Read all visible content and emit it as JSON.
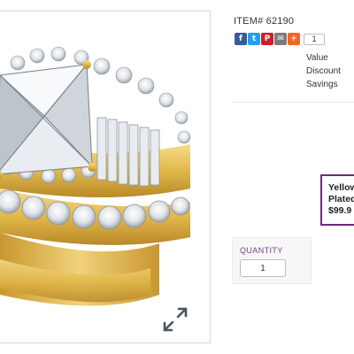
{
  "product": {
    "item_number": "ITEM# 62190",
    "image_alt": "Princess-cut cubic zirconia bridal ring set, yellow gold plated"
  },
  "share": {
    "buttons": [
      {
        "icon": "facebook-icon",
        "glyph": "f",
        "color": "#3b5998"
      },
      {
        "icon": "twitter-icon",
        "glyph": "t",
        "color": "#1da1f2"
      },
      {
        "icon": "pinterest-icon",
        "glyph": "P",
        "color": "#cb2027"
      },
      {
        "icon": "email-icon",
        "glyph": "✉",
        "color": "#7a7a7a"
      },
      {
        "icon": "more-share-icon",
        "glyph": "+",
        "color": "#f26522"
      }
    ],
    "count": "1"
  },
  "pricing": {
    "value_label": "Value",
    "discount_label": "Discount",
    "savings_label": "Savings"
  },
  "promo": {
    "line1": "Yellow",
    "line2": "Plated",
    "price": "$99.9"
  },
  "quantity": {
    "label": "QUANTITY",
    "value": "1"
  },
  "colors": {
    "accent_purple": "#6b2a7a",
    "gold": "#e2b84a"
  }
}
